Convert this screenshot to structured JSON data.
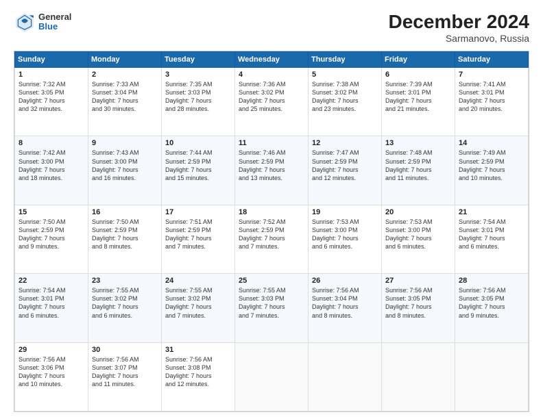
{
  "logo": {
    "line1": "General",
    "line2": "Blue"
  },
  "title": "December 2024",
  "subtitle": "Sarmanovo, Russia",
  "days_of_week": [
    "Sunday",
    "Monday",
    "Tuesday",
    "Wednesday",
    "Thursday",
    "Friday",
    "Saturday"
  ],
  "weeks": [
    [
      {
        "day": "1",
        "info": "Sunrise: 7:32 AM\nSunset: 3:05 PM\nDaylight: 7 hours\nand 32 minutes."
      },
      {
        "day": "2",
        "info": "Sunrise: 7:33 AM\nSunset: 3:04 PM\nDaylight: 7 hours\nand 30 minutes."
      },
      {
        "day": "3",
        "info": "Sunrise: 7:35 AM\nSunset: 3:03 PM\nDaylight: 7 hours\nand 28 minutes."
      },
      {
        "day": "4",
        "info": "Sunrise: 7:36 AM\nSunset: 3:02 PM\nDaylight: 7 hours\nand 25 minutes."
      },
      {
        "day": "5",
        "info": "Sunrise: 7:38 AM\nSunset: 3:02 PM\nDaylight: 7 hours\nand 23 minutes."
      },
      {
        "day": "6",
        "info": "Sunrise: 7:39 AM\nSunset: 3:01 PM\nDaylight: 7 hours\nand 21 minutes."
      },
      {
        "day": "7",
        "info": "Sunrise: 7:41 AM\nSunset: 3:01 PM\nDaylight: 7 hours\nand 20 minutes."
      }
    ],
    [
      {
        "day": "8",
        "info": "Sunrise: 7:42 AM\nSunset: 3:00 PM\nDaylight: 7 hours\nand 18 minutes."
      },
      {
        "day": "9",
        "info": "Sunrise: 7:43 AM\nSunset: 3:00 PM\nDaylight: 7 hours\nand 16 minutes."
      },
      {
        "day": "10",
        "info": "Sunrise: 7:44 AM\nSunset: 2:59 PM\nDaylight: 7 hours\nand 15 minutes."
      },
      {
        "day": "11",
        "info": "Sunrise: 7:46 AM\nSunset: 2:59 PM\nDaylight: 7 hours\nand 13 minutes."
      },
      {
        "day": "12",
        "info": "Sunrise: 7:47 AM\nSunset: 2:59 PM\nDaylight: 7 hours\nand 12 minutes."
      },
      {
        "day": "13",
        "info": "Sunrise: 7:48 AM\nSunset: 2:59 PM\nDaylight: 7 hours\nand 11 minutes."
      },
      {
        "day": "14",
        "info": "Sunrise: 7:49 AM\nSunset: 2:59 PM\nDaylight: 7 hours\nand 10 minutes."
      }
    ],
    [
      {
        "day": "15",
        "info": "Sunrise: 7:50 AM\nSunset: 2:59 PM\nDaylight: 7 hours\nand 9 minutes."
      },
      {
        "day": "16",
        "info": "Sunrise: 7:50 AM\nSunset: 2:59 PM\nDaylight: 7 hours\nand 8 minutes."
      },
      {
        "day": "17",
        "info": "Sunrise: 7:51 AM\nSunset: 2:59 PM\nDaylight: 7 hours\nand 7 minutes."
      },
      {
        "day": "18",
        "info": "Sunrise: 7:52 AM\nSunset: 2:59 PM\nDaylight: 7 hours\nand 7 minutes."
      },
      {
        "day": "19",
        "info": "Sunrise: 7:53 AM\nSunset: 3:00 PM\nDaylight: 7 hours\nand 6 minutes."
      },
      {
        "day": "20",
        "info": "Sunrise: 7:53 AM\nSunset: 3:00 PM\nDaylight: 7 hours\nand 6 minutes."
      },
      {
        "day": "21",
        "info": "Sunrise: 7:54 AM\nSunset: 3:01 PM\nDaylight: 7 hours\nand 6 minutes."
      }
    ],
    [
      {
        "day": "22",
        "info": "Sunrise: 7:54 AM\nSunset: 3:01 PM\nDaylight: 7 hours\nand 6 minutes."
      },
      {
        "day": "23",
        "info": "Sunrise: 7:55 AM\nSunset: 3:02 PM\nDaylight: 7 hours\nand 6 minutes."
      },
      {
        "day": "24",
        "info": "Sunrise: 7:55 AM\nSunset: 3:02 PM\nDaylight: 7 hours\nand 7 minutes."
      },
      {
        "day": "25",
        "info": "Sunrise: 7:55 AM\nSunset: 3:03 PM\nDaylight: 7 hours\nand 7 minutes."
      },
      {
        "day": "26",
        "info": "Sunrise: 7:56 AM\nSunset: 3:04 PM\nDaylight: 7 hours\nand 8 minutes."
      },
      {
        "day": "27",
        "info": "Sunrise: 7:56 AM\nSunset: 3:05 PM\nDaylight: 7 hours\nand 8 minutes."
      },
      {
        "day": "28",
        "info": "Sunrise: 7:56 AM\nSunset: 3:05 PM\nDaylight: 7 hours\nand 9 minutes."
      }
    ],
    [
      {
        "day": "29",
        "info": "Sunrise: 7:56 AM\nSunset: 3:06 PM\nDaylight: 7 hours\nand 10 minutes."
      },
      {
        "day": "30",
        "info": "Sunrise: 7:56 AM\nSunset: 3:07 PM\nDaylight: 7 hours\nand 11 minutes."
      },
      {
        "day": "31",
        "info": "Sunrise: 7:56 AM\nSunset: 3:08 PM\nDaylight: 7 hours\nand 12 minutes."
      },
      {
        "day": "",
        "info": ""
      },
      {
        "day": "",
        "info": ""
      },
      {
        "day": "",
        "info": ""
      },
      {
        "day": "",
        "info": ""
      }
    ]
  ]
}
